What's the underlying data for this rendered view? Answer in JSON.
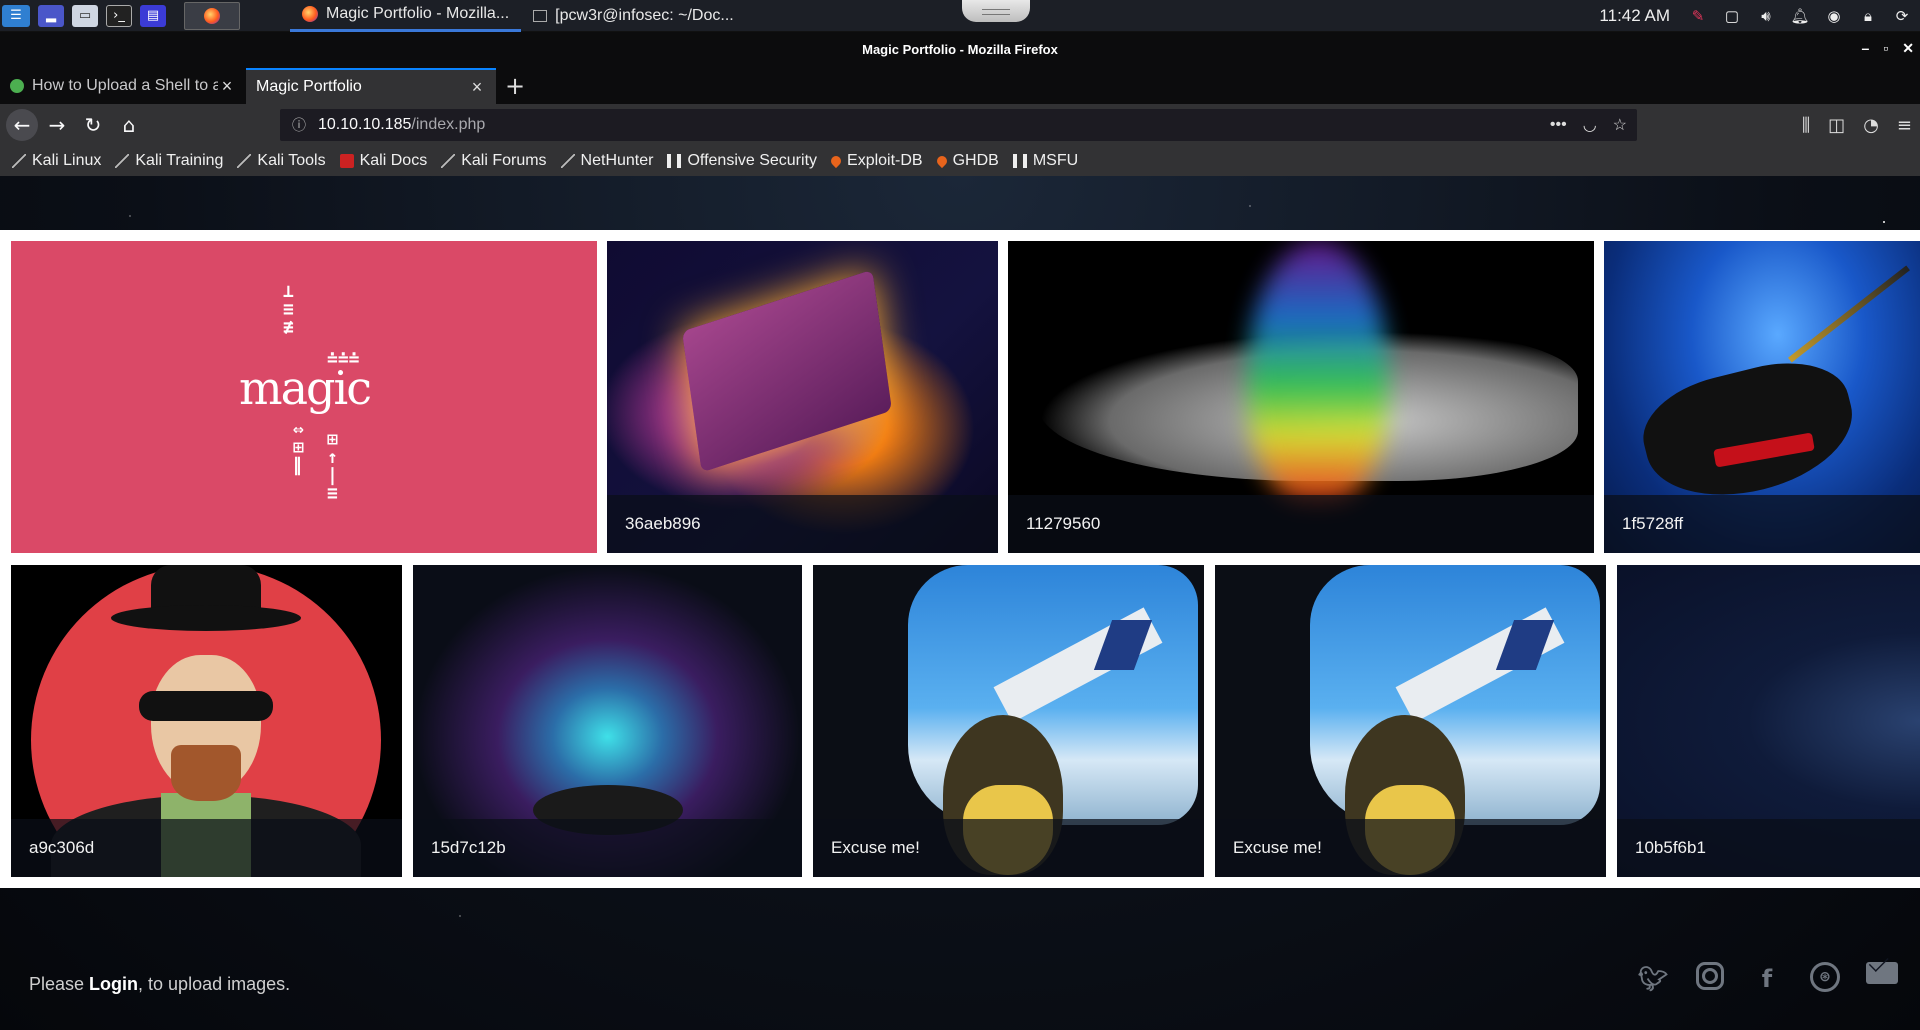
{
  "taskbar": {
    "tasks": [
      {
        "title": "Magic Portfolio - Mozilla...",
        "icon": "firefox-icon"
      },
      {
        "title": "[pcw3r@infosec: ~/Doc...",
        "icon": "terminal-icon"
      }
    ],
    "clock": "11:42 AM"
  },
  "window": {
    "title": "Magic Portfolio - Mozilla Firefox"
  },
  "tabs": [
    {
      "label": "How to Upload a Shell to a Web Server and Get Root (RFI)",
      "active": false
    },
    {
      "label": "Magic Portfolio",
      "active": true
    }
  ],
  "urlbar": {
    "host": "10.10.10.185",
    "path": "/index.php"
  },
  "bookmarks": [
    {
      "label": "Kali Linux",
      "icon": "kali-dragon-icon"
    },
    {
      "label": "Kali Training",
      "icon": "kali-dragon-icon"
    },
    {
      "label": "Kali Tools",
      "icon": "kali-dragon-icon"
    },
    {
      "label": "Kali Docs",
      "icon": "kali-docs-icon"
    },
    {
      "label": "Kali Forums",
      "icon": "kali-dragon-icon"
    },
    {
      "label": "NetHunter",
      "icon": "kali-dragon-icon"
    },
    {
      "label": "Offensive Security",
      "icon": "offsec-icon"
    },
    {
      "label": "Exploit-DB",
      "icon": "flame-icon"
    },
    {
      "label": "GHDB",
      "icon": "flame-icon"
    },
    {
      "label": "MSFU",
      "icon": "offsec-icon"
    }
  ],
  "gallery": {
    "logo_text": "magic",
    "captions": [
      "36aeb896",
      "11279560",
      "1f5728ff",
      "a9c306d",
      "15d7c12b",
      "Excuse me!",
      "Excuse me!",
      "10b5f6b1"
    ]
  },
  "footer": {
    "prefix": "Please ",
    "login": "Login",
    "suffix": ", to upload images."
  },
  "colors": {
    "accent": "#0a84ff",
    "logo_tile": "#da4967"
  }
}
